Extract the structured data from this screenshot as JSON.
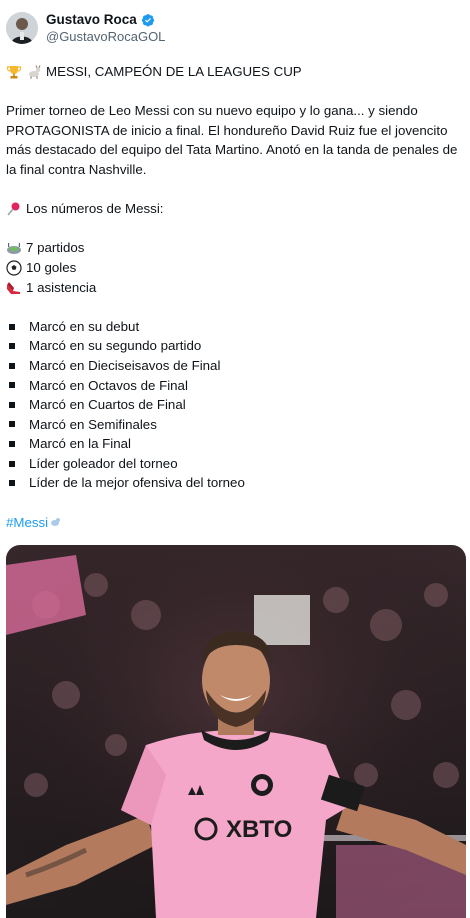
{
  "author": {
    "name": "Gustavo Roca",
    "handle": "@GustavoRocaGOL",
    "verified": true
  },
  "tweet": {
    "headline": "MESSI, CAMPEÓN DE LA LEAGUES CUP",
    "body": "Primer torneo de Leo Messi con su nuevo equipo y lo gana... y siendo PROTAGONISTA de inicio a final. El hondureño David Ruiz fue el jovencito más destacado del equipo del Tata Martino. Anotó en la tanda de penales de la final contra Nashville.",
    "numbers_intro": "Los números de Messi:",
    "stats": [
      {
        "icon": "stadium-icon",
        "text": "7 partidos"
      },
      {
        "icon": "soccer-ball-icon",
        "text": "10 goles"
      },
      {
        "icon": "cleat-icon",
        "text": "1 asistencia"
      }
    ],
    "bullets": [
      "Marcó en su debut",
      "Marcó en su segundo partido",
      "Marcó en Dieciseisavos de Final",
      "Marcó en Octavos de Final",
      "Marcó en Cuartos de Final",
      "Marcó en Semifinales",
      "Marcó en la Final",
      "Líder goleador del torneo",
      "Líder de la mejor ofensiva del torneo"
    ],
    "hashtag": "#Messi"
  },
  "media": {
    "jersey_sponsor": "XBTO",
    "accent_color": "#f4a7c9"
  },
  "colors": {
    "link": "#1d9bf0",
    "text": "#0f1419",
    "secondary": "#536471"
  }
}
